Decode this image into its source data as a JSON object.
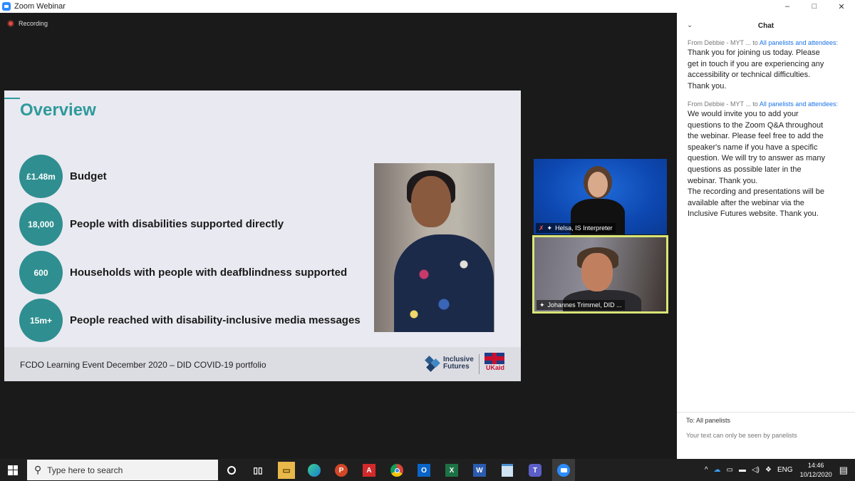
{
  "window": {
    "title": "Zoom Webinar",
    "controls": [
      "–",
      "□",
      "✕"
    ]
  },
  "recording": {
    "label": "Recording"
  },
  "slide": {
    "title": "Overview",
    "stats": [
      {
        "value": "£1.48m",
        "label": "Budget"
      },
      {
        "value": "18,000",
        "label": "People with disabilities supported directly"
      },
      {
        "value": "600",
        "label": "Households with people with deafblindness supported"
      },
      {
        "value": "15m+",
        "label": "People reached with disability-inclusive media messages"
      }
    ],
    "footer": "FCDO Learning Event December 2020 – DID COVID-19 portfolio",
    "logo_if": "Inclusive Futures",
    "logo_ukaid": "UKaid"
  },
  "videos": [
    {
      "name": "Helsa, IS Interpreter"
    },
    {
      "name": "Johannes Trimmel, DID ..."
    }
  ],
  "chat": {
    "title": "Chat",
    "messages": [
      {
        "from": "From Debbie - MYT ...",
        "to_word": "to",
        "recipients": "All panelists and attendees:",
        "body": "Thank you for joining us today. Please\nget in touch if you are experiencing any\naccessibility or technical difficulties.\nThank you."
      },
      {
        "from": "From Debbie - MYT ...",
        "to_word": "to",
        "recipients": "All panelists and attendees:",
        "body": "We would invite you to add your\nquestions to the Zoom Q&A throughout\nthe webinar. Please feel free to add the\nspeaker's name if you have a specific\nquestion.  We will try to answer as many\nquestions as possible later in the\nwebinar. Thank you.\nThe recording and presentations will be\navailable after the webinar via the\nInclusive Futures website.  Thank you."
      }
    ],
    "to_line": "To:  All panelists",
    "hint": "Your text can only be seen by panelists"
  },
  "taskbar": {
    "search_placeholder": "Type here to search",
    "apps": [
      "cortana",
      "task-view",
      "file-explorer",
      "edge",
      "powerpoint",
      "acrobat",
      "chrome",
      "outlook",
      "excel",
      "word",
      "notepad",
      "teams",
      "zoom"
    ],
    "language": "ENG",
    "time": "14:46",
    "date": "10/12/2020"
  }
}
